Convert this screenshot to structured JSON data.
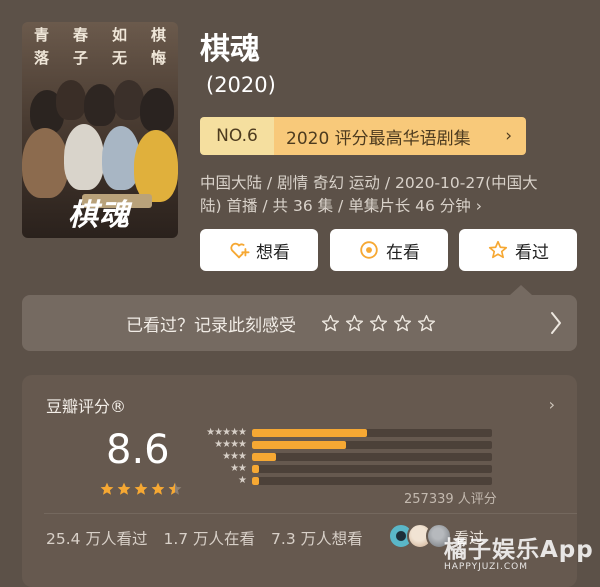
{
  "poster": {
    "verse": [
      "青",
      "春",
      "如",
      "棋",
      "落",
      "子",
      "无",
      "悔"
    ],
    "logo_text": "棋魂"
  },
  "show": {
    "title": "棋魂",
    "year": "(2020)",
    "rank_no": "NO.6",
    "rank_label": "2020 评分最高华语剧集",
    "meta_line1": "中国大陆 / 剧情 奇幻 运动 / 2020-10-27(中国大",
    "meta_line2": "陆) 首播 / 共 36 集 / 单集片长 46 分钟 ›"
  },
  "actions": {
    "want": "想看",
    "watching": "在看",
    "watched": "看过"
  },
  "record": {
    "prompt": "已看过？记录此刻感受"
  },
  "rating": {
    "title": "豆瓣评分®",
    "score": "8.6",
    "score_stars": 4.5,
    "distribution": [
      {
        "stars": "★★★★★",
        "fraction": 0.48
      },
      {
        "stars": "★★★★",
        "fraction": 0.39
      },
      {
        "stars": "★★★",
        "fraction": 0.1
      },
      {
        "stars": "★★",
        "fraction": 0.03
      },
      {
        "stars": "★",
        "fraction": 0.03
      }
    ],
    "count": "257339 人评分",
    "stat_watched": "25.4 万人看过",
    "stat_watching": "1.7 万人在看",
    "stat_want": "7.3 万人想看",
    "friends_text": "看过"
  },
  "watermark": {
    "cn": "橘子娱乐App",
    "en": "HAPPYJUZI.COM"
  },
  "colors": {
    "background": "#5c5148",
    "accent_orange": "#f6a833",
    "rank_light": "#f5df9f",
    "rank_dark": "#f8c97a"
  }
}
